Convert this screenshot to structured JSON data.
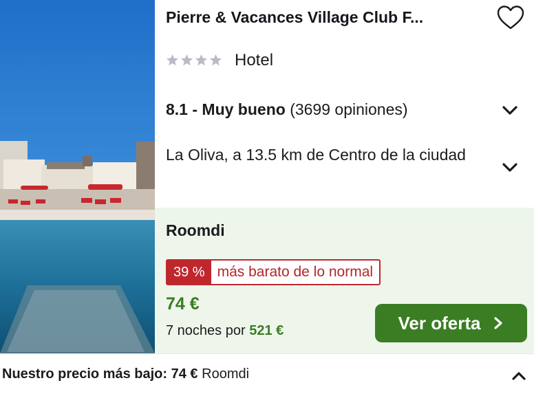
{
  "hotel": {
    "title": "Pierre & Vacances Village Club F...",
    "stars": 4,
    "type": "Hotel",
    "rating_score": "8.1 - Muy bueno",
    "rating_reviews": "(3699 opiniones)",
    "location": "La Oliva, a 13.5 km de Centro de la ciudad"
  },
  "deal": {
    "provider": "Roomdi",
    "discount_pct": "39 %",
    "discount_text": "más barato de lo normal",
    "price": "74 €",
    "nights_text": "7 noches por",
    "nights_total": "521 €",
    "cta_label": "Ver oferta"
  },
  "footer": {
    "label": "Nuestro precio más bajo:",
    "price": "74 €",
    "provider": "Roomdi"
  },
  "icons": {
    "favorite": "heart-outline-icon",
    "expand": "chevron-down-icon",
    "collapse": "chevron-up-icon",
    "cta": "chevron-right-icon"
  },
  "colors": {
    "accent_green": "#3a7d23",
    "deal_background": "#eef6ec",
    "discount_red": "#c0272d",
    "star_gray": "#b9bcc4"
  }
}
